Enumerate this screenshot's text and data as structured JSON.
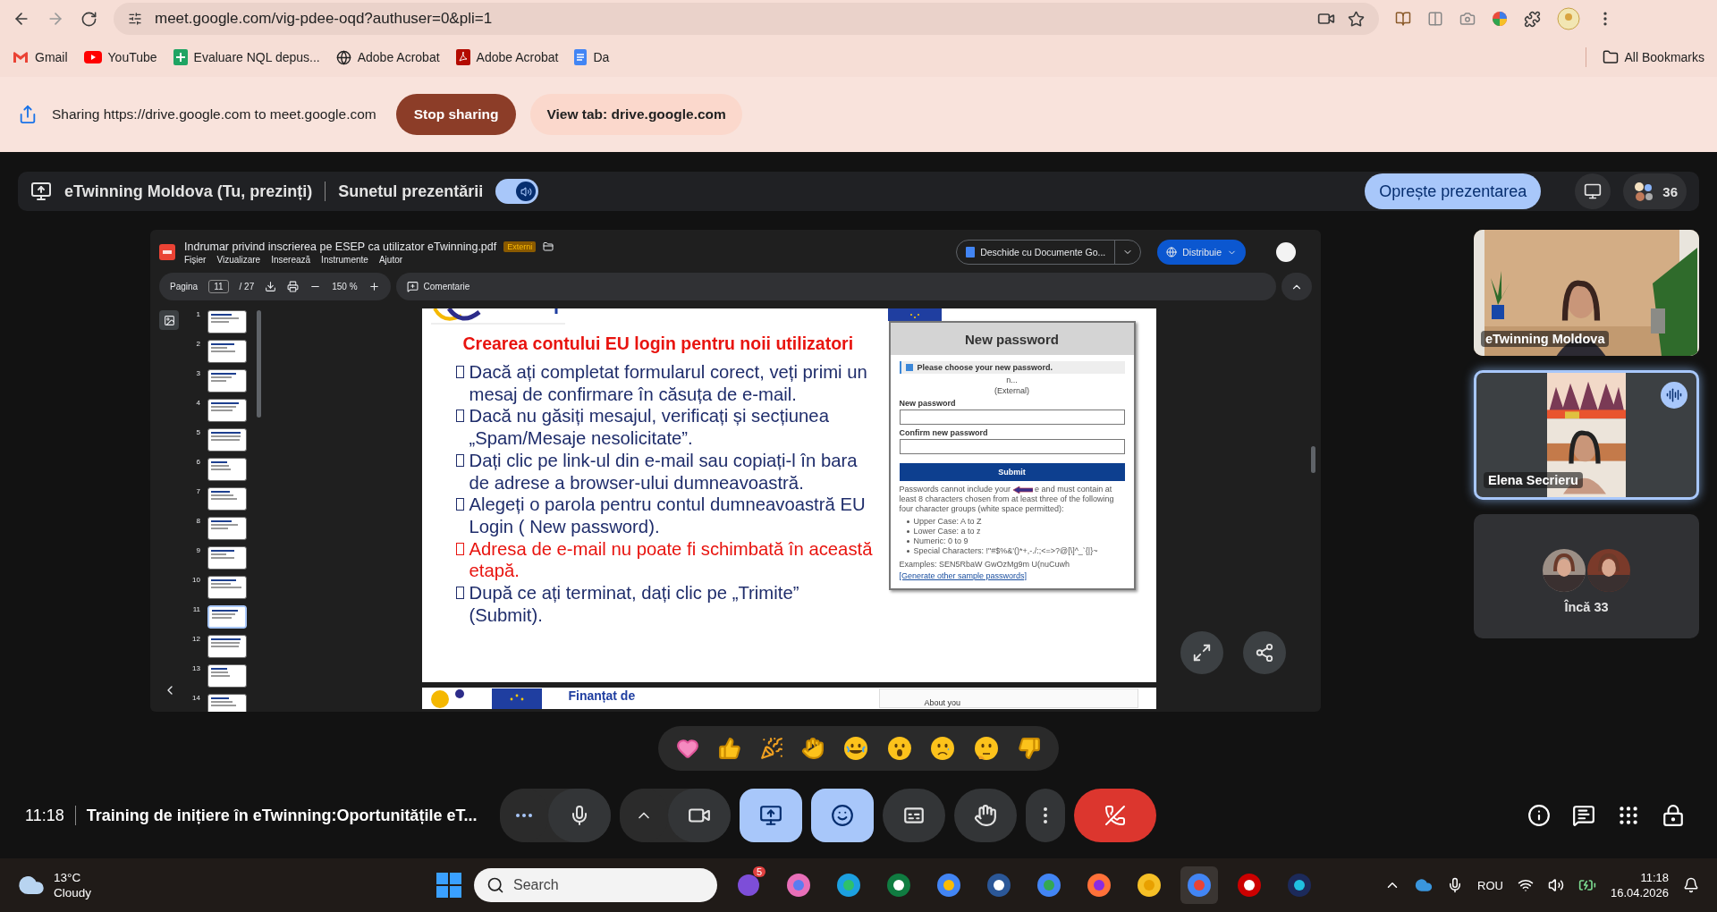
{
  "browser": {
    "url": "meet.google.com/vig-pdee-oqd?authuser=0&pli=1",
    "bookmarks": [
      {
        "kind": "mail",
        "label": "Gmail"
      },
      {
        "kind": "video",
        "label": "YouTube"
      },
      {
        "kind": "sheet",
        "label": "Evaluare NQL depus..."
      },
      {
        "kind": "globe",
        "label": "Adobe Acrobat"
      },
      {
        "kind": "pdf",
        "label": "Adobe Acrobat"
      },
      {
        "kind": "doc",
        "label": "Da"
      }
    ],
    "all_bookmarks": "All Bookmarks"
  },
  "sharing_bar": {
    "message": "Sharing https://drive.google.com to meet.google.com",
    "stop_button": "Stop sharing",
    "view_button": "View tab: drive.google.com"
  },
  "presentation_bar": {
    "presenter": "eTwinning Moldova (Tu, prezinți)",
    "sound_label": "Sunetul prezentării",
    "sound_on": true,
    "stop_button": "Oprește prezentarea",
    "participant_count": "36"
  },
  "pdf_viewer": {
    "file_name": "Indrumar privind inscrierea pe ESEP ca utilizator eTwinning.pdf",
    "badge": "Externi",
    "menu": [
      "Fișier",
      "Vizualizare",
      "Inserează",
      "Instrumente",
      "Ajutor"
    ],
    "open_with": "Deschide cu Documente Go...",
    "share_button": "Distribuie",
    "page_label": "Pagina",
    "page": "11",
    "page_total": "/ 27",
    "zoom": "150 %",
    "comment_button": "Comentarie",
    "thumbnails": [
      {
        "number": "1",
        "selected": false
      },
      {
        "number": "2",
        "selected": false
      },
      {
        "number": "3",
        "selected": false
      },
      {
        "number": "4",
        "selected": false
      },
      {
        "number": "5",
        "selected": false
      },
      {
        "number": "6",
        "selected": false
      },
      {
        "number": "7",
        "selected": false
      },
      {
        "number": "8",
        "selected": false
      },
      {
        "number": "9",
        "selected": false
      },
      {
        "number": "10",
        "selected": false
      },
      {
        "number": "11",
        "selected": true
      },
      {
        "number": "12",
        "selected": false
      },
      {
        "number": "13",
        "selected": false
      },
      {
        "number": "14",
        "selected": false
      }
    ],
    "slide": {
      "title": "Crearea contului EU login pentru noii utilizatori",
      "items": [
        {
          "text": "Dacă ați completat formularul corect, veți primi un mesaj de confirmare în căsuța de e-mail.",
          "color": "#1f2d6b"
        },
        {
          "text": "Dacă nu găsiți mesajul, verificați și secțiunea „Spam/Mesaje nesolicitate”.",
          "color": "#1f2d6b"
        },
        {
          "text": "Dați clic pe link-ul din e-mail sau copiați-l în bara de adrese a browser-ului dumneavoastră.",
          "color": "#1f2d6b"
        },
        {
          "text": "Alegeți o parola pentru contul dumneavoastră EU Login ( New password).",
          "color": "#1f2d6b"
        },
        {
          "text": "Adresa de e-mail nu poate fi schimbată în această etapă.",
          "color": "#e8140f"
        },
        {
          "text": "După ce ați terminat, dați clic pe „Trimite” (Submit).",
          "color": "#1f2d6b"
        }
      ],
      "form": {
        "heading": "New password",
        "notice": "Please choose your new password.",
        "user": "n...",
        "user_note": "(External)",
        "fields": [
          {
            "label": "New password"
          },
          {
            "label": "Confirm new password"
          }
        ],
        "submit": "Submit",
        "rules_start": "Passwords cannot include your",
        "rules_end": "e and must contain at least 8 characters chosen from at least three of the following four character groups (white space permitted):",
        "rules": [
          "Upper Case: A to Z",
          "Lower Case: a to z",
          "Numeric: 0 to 9",
          "Special Characters: !\"#$%&'()*+,-./:;<=>?@[\\]^_`{|}~"
        ],
        "examples": "Examples: SEN5RbaW GwOzMg9m U(nuCuwh",
        "generate_link": "[Generate other sample passwords]"
      }
    },
    "next_slide": {
      "heading": "Finanțat de",
      "field": "About you"
    }
  },
  "participants": [
    {
      "kind": "video",
      "name": "eTwinning Moldova",
      "speaking": false
    },
    {
      "kind": "video",
      "name": "Elena Secrieru",
      "speaking": true
    },
    {
      "kind": "others",
      "name": "Încă 33",
      "speaking": false
    }
  ],
  "meeting": {
    "time": "11:18",
    "title": "Training de inițiere în eTwinning:Oportunitățile eT...",
    "controls": [
      {
        "kind": "more",
        "active": false
      },
      {
        "kind": "mic",
        "active": false
      },
      {
        "kind": "options",
        "active": false
      },
      {
        "kind": "camera",
        "active": false
      },
      {
        "kind": "present",
        "active": true
      },
      {
        "kind": "reactions",
        "active": true
      },
      {
        "kind": "captions",
        "active": false
      },
      {
        "kind": "hand",
        "active": false
      },
      {
        "kind": "menu",
        "active": false
      },
      {
        "kind": "leave",
        "active": false
      }
    ]
  },
  "taskbar": {
    "temperature": "13°C",
    "weather": "Cloudy",
    "search_placeholder": "Search",
    "chat_badge": "5",
    "language": "ROU",
    "time": "11:18",
    "date": "16.04.2026"
  }
}
